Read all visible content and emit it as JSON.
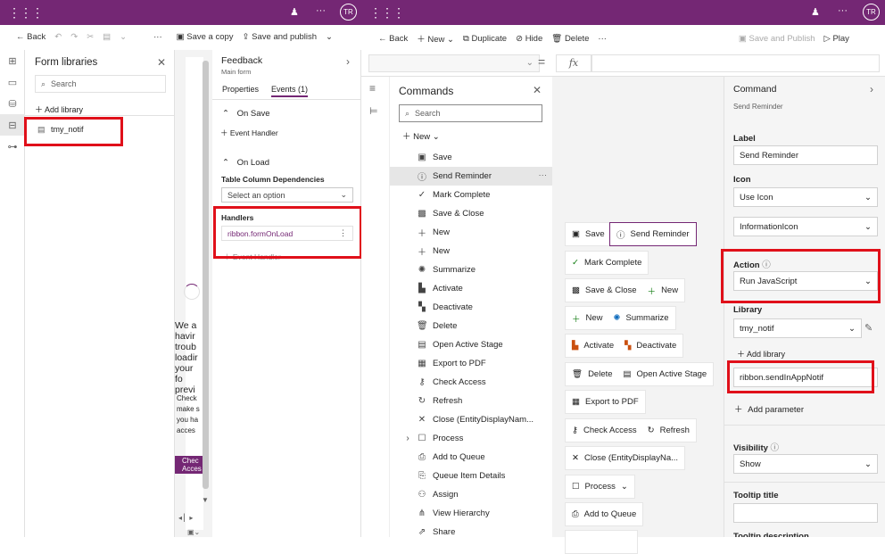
{
  "topbar_left": {
    "avatar": "TR",
    "more": "···"
  },
  "topbar_right": {
    "avatar": "TR",
    "more": "···"
  },
  "left_cmd": {
    "back": "Back",
    "save_copy": "Save a copy",
    "save_publish": "Save and publish"
  },
  "right_cmd": {
    "back": "Back",
    "new": "New",
    "duplicate": "Duplicate",
    "hide": "Hide",
    "delete": "Delete",
    "more": "···",
    "save_publish": "Save and Publish",
    "play": "Play"
  },
  "formlib": {
    "title": "Form libraries",
    "search_placeholder": "Search",
    "add_library": "Add library",
    "item": "tmy_notif"
  },
  "preview": {
    "error_title": "We a havir troub loadir your fo previ",
    "error_body": "Check make s you ha acces",
    "button": "Chec Acces"
  },
  "feedback": {
    "title": "Feedback",
    "subtitle": "Main form",
    "tabs": [
      "Properties",
      "Events (1)"
    ],
    "on_save": "On Save",
    "event_handler": "Event Handler",
    "on_load": "On Load",
    "table_deps": "Table Column Dependencies",
    "select_placeholder": "Select an option",
    "handlers": "Handlers",
    "handler_item": "ribbon.formOnLoad",
    "event_handler_2": "Event Handler"
  },
  "formula": {
    "fx": "fx",
    "eq": "="
  },
  "commands": {
    "title": "Commands",
    "search_placeholder": "Search",
    "new": "New",
    "items": [
      {
        "label": "Save",
        "icon": "save-icon"
      },
      {
        "label": "Send Reminder",
        "icon": "info-icon"
      },
      {
        "label": "Mark Complete",
        "icon": "check-icon"
      },
      {
        "label": "Save & Close",
        "icon": "save-close-icon"
      },
      {
        "label": "New",
        "icon": "plus-icon"
      },
      {
        "label": "New",
        "icon": "plus-icon"
      },
      {
        "label": "Summarize",
        "icon": "summarize-icon"
      },
      {
        "label": "Activate",
        "icon": "activate-icon"
      },
      {
        "label": "Deactivate",
        "icon": "deactivate-icon"
      },
      {
        "label": "Delete",
        "icon": "delete-icon"
      },
      {
        "label": "Open Active Stage",
        "icon": "stage-icon"
      },
      {
        "label": "Export to PDF",
        "icon": "pdf-icon"
      },
      {
        "label": "Check Access",
        "icon": "key-icon"
      },
      {
        "label": "Refresh",
        "icon": "refresh-icon"
      },
      {
        "label": "Close (EntityDisplayNam...",
        "icon": "close-icon"
      },
      {
        "label": "Process",
        "icon": "chevron-right-icon"
      },
      {
        "label": "Add to Queue",
        "icon": "queue-icon"
      },
      {
        "label": "Queue Item Details",
        "icon": "queue-details-icon"
      },
      {
        "label": "Assign",
        "icon": "assign-icon"
      },
      {
        "label": "View Hierarchy",
        "icon": "hierarchy-icon"
      },
      {
        "label": "Share",
        "icon": "share-icon"
      }
    ]
  },
  "canvas": {
    "save": "Save",
    "send_reminder": "Send Reminder",
    "mark_complete": "Mark Complete",
    "save_close": "Save & Close",
    "new": "New",
    "summarize": "Summarize",
    "activate": "Activate",
    "deactivate": "Deactivate",
    "delete": "Delete",
    "open_active_stage": "Open Active Stage",
    "export_pdf": "Export to PDF",
    "check_access": "Check Access",
    "refresh": "Refresh",
    "close": "Close (EntityDisplayNa...",
    "process": "Process",
    "add_queue": "Add to Queue"
  },
  "props": {
    "title": "Command",
    "subtitle": "Send Reminder",
    "label_label": "Label",
    "label_value": "Send Reminder",
    "icon_label": "Icon",
    "icon_mode": "Use Icon",
    "icon_value": "InformationIcon",
    "action_label": "Action",
    "action_value": "Run JavaScript",
    "library_label": "Library",
    "library_value": "tmy_notif",
    "add_library": "Add library",
    "function_value": "ribbon.sendInAppNotif",
    "add_parameter": "Add parameter",
    "visibility_label": "Visibility",
    "visibility_value": "Show",
    "tooltip_title": "Tooltip title",
    "tooltip_desc": "Tooltip description"
  },
  "colors": {
    "brand": "#742774",
    "highlight": "#e0101a",
    "selected": "#e6e6e6"
  }
}
